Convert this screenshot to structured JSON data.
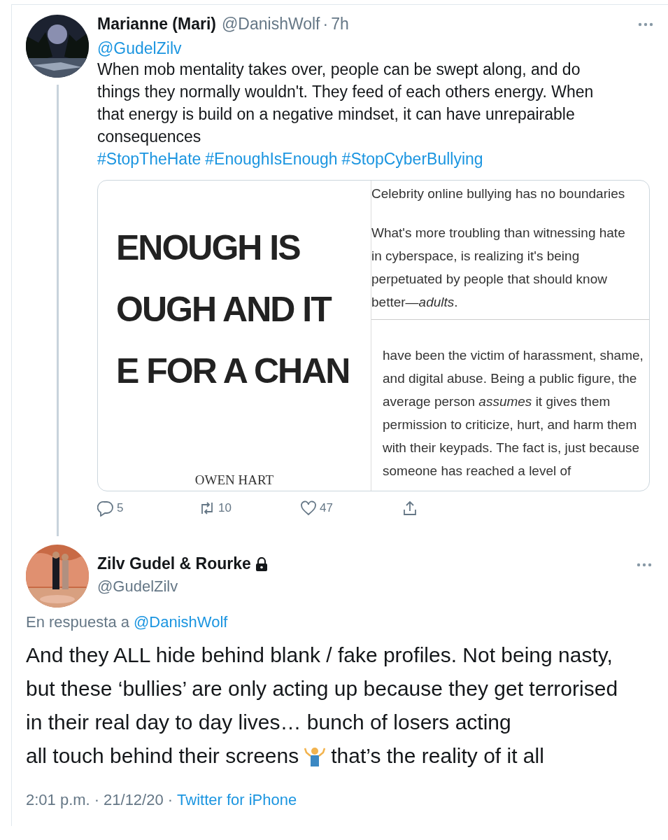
{
  "reply_tweet": {
    "name": "Marianne (Mari)",
    "handle": "@DanishWolf",
    "separator": "·",
    "time": "7h",
    "mention": "@GudelZilv",
    "text": "When mob mentality takes over, people can be swept along, and do things they normally wouldn't. They feed of each others energy. When that energy is build on a negative mindset, it can have unrepairable consequences",
    "hashtags": [
      "#StopTheHate",
      "#EnoughIsEnough",
      "#StopCyberBullying"
    ],
    "attachment": {
      "cover_lines": [
        "ENOUGH IS",
        "OUGH AND IT",
        "E FOR A CHAN"
      ],
      "cover_author": "OWEN HART",
      "top_title": "Celebrity online bullying has no boundaries",
      "top_text": "What's more troubling than witnessing hate in cyberspace, is realizing it's being perpetuated by people that should know better—*adults*.",
      "bottom_text": "have been the victim of harassment, shame, and digital abuse. Being a public figure, the average person *assumes* it gives them permission to criticize, hurt, and harm them with their keypads. The fact is, just because someone has reached a level of"
    },
    "actions": [
      {
        "kind": "reply",
        "count": "5"
      },
      {
        "kind": "retweet",
        "count": "10"
      },
      {
        "kind": "like",
        "count": "47"
      },
      {
        "kind": "share"
      }
    ]
  },
  "main_tweet": {
    "name": "Zilv Gudel & Rourke",
    "protected": true,
    "handle": "@GudelZilv",
    "reply_prefix": "En respuesta a",
    "reply_to": "@DanishWolf",
    "text_before": "And they ALL hide behind blank / fake profiles. Not being nasty, but these ‘bullies’ are only acting up because they get terrorised in their real day to day lives… bunch of losers acting",
    "text_last_line": "all touch behind their screens",
    "text_after": "that’s the reality of it all",
    "time": "2:01 p.m.",
    "date": "21/12/20",
    "source": "Twitter for iPhone",
    "meta_separators": [
      "·",
      "·"
    ]
  }
}
